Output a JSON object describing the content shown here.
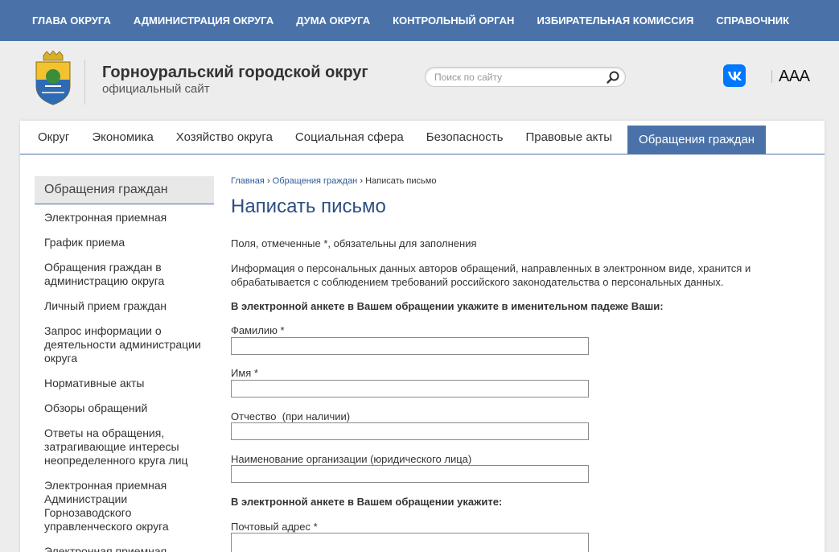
{
  "topnav": [
    "ГЛАВА ОКРУГА",
    "АДМИНИСТРАЦИЯ ОКРУГА",
    "ДУМА ОКРУГА",
    "КОНТРОЛЬНЫЙ ОРГАН",
    "ИЗБИРАТЕЛЬНАЯ КОМИССИЯ",
    "СПРАВОЧНИК"
  ],
  "header": {
    "title": "Горноуральский городской округ",
    "subtitle": "официальный сайт",
    "search_placeholder": "Поиск по сайту",
    "accessibility_label": "AAA"
  },
  "mainnav": [
    "Округ",
    "Экономика",
    "Хозяйство округа",
    "Социальная сфера",
    "Безопасность",
    "Правовые акты",
    "Обращения граждан"
  ],
  "sidebar": {
    "heading": "Обращения граждан",
    "items": [
      "Электронная приемная",
      "График приема",
      "Обращения граждан в администрацию округа",
      "Личный прием граждан",
      "Запрос информации о деятельности администрации округа",
      "Нормативные акты",
      "Обзоры обращений",
      "Ответы на обращения, затрагивающие интересы неопределенного круга лиц",
      "Электронная приемная Администрации Горнозаводского управленческого округа",
      "Электронная приемная"
    ]
  },
  "breadcrumb": {
    "home": "Главная",
    "separator": "›",
    "section": "Обращения граждан",
    "current": "Написать письмо"
  },
  "page": {
    "title": "Написать письмо",
    "required_note": "Поля, отмеченные *, обязательны для заполнения",
    "privacy_note": "Информация о персональных данных авторов обращений, направленных в электронном виде, хранится и обрабатывается с соблюдением требований российского законодательства о персональных данных.",
    "section1": "В электронной анкете в Вашем обращении укажите в именительном падеже Ваши:",
    "section2": "В электронной анкете в Вашем обращении укажите:"
  },
  "form": {
    "surname_label": "Фамилию *",
    "name_label": "Имя *",
    "patronymic_label": "Отчество  (при наличии)",
    "organization_label": "Наименование организации (юридического лица)",
    "postal_label": "Почтовый адрес *"
  },
  "colors": {
    "accent": "#4a72a8",
    "title": "#2d4f80",
    "vk": "#0077ff"
  }
}
